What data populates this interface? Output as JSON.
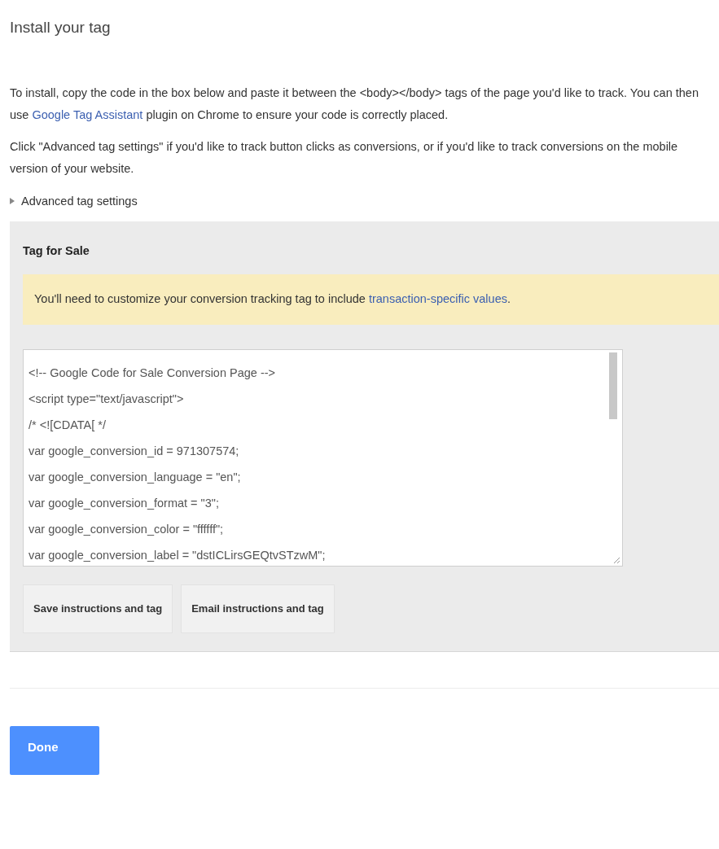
{
  "title": "Install your tag",
  "intro": {
    "before": "To install, copy the code in the box below and paste it between the <body></body> tags of the page you'd like to track. You can then use ",
    "link": "Google Tag Assistant",
    "after": " plugin on Chrome to ensure your code is correctly placed."
  },
  "advanced_note": "Click \"Advanced tag settings\" if you'd like to track button clicks as conversions, or if you'd like to track conversions on the mobile version of your website.",
  "advanced_toggle": {
    "label": "Advanced tag settings",
    "expanded": false
  },
  "tag_panel": {
    "title": "Tag for Sale",
    "notice": {
      "text": "You'll need to customize your conversion tracking tag to include ",
      "link": "transaction-specific values",
      "after": "."
    },
    "code_lines": [
      "<!-- Google Code for Sale Conversion Page -->",
      "<script type=\"text/javascript\">",
      "/* <![CDATA[ */",
      "var google_conversion_id = 971307574;",
      "var google_conversion_language = \"en\";",
      "var google_conversion_format = \"3\";",
      "var google_conversion_color = \"ffffff\";",
      "var google_conversion_label = \"dstICLirsGEQtvSTzwM\";"
    ],
    "buttons": [
      "Save instructions and tag",
      "Email instructions and tag"
    ]
  },
  "done_button": "Done"
}
